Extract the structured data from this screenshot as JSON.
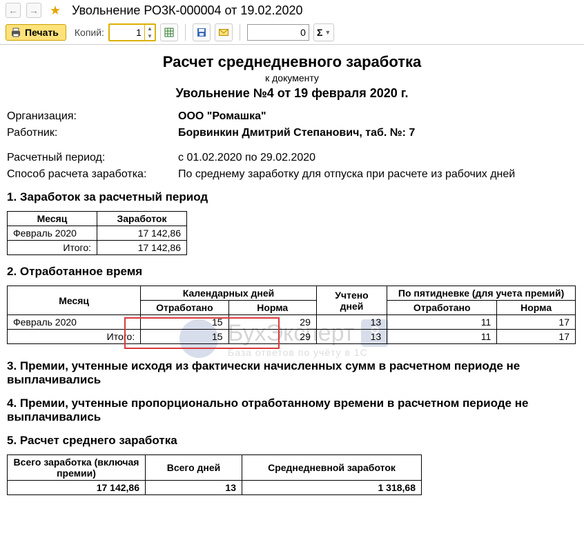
{
  "nav": {
    "back": "←",
    "forward": "→",
    "star": "★",
    "title": "Увольнение РО3К-000004 от 19.02.2020"
  },
  "toolbar": {
    "print_label": "Печать",
    "copies_label": "Копий:",
    "copies_value": "1",
    "num_value": "0",
    "sigma": "Σ"
  },
  "doc": {
    "title1": "Расчет среднедневного заработка",
    "title2": "к документу",
    "title3": "Увольнение №4 от 19 февраля 2020 г.",
    "org_label": "Организация:",
    "org_value": "ООО \"Ромашка\"",
    "worker_label": "Работник:",
    "worker_value": "Борвинкин Дмитрий Степанович, таб. №: 7",
    "period_label": "Расчетный период:",
    "period_value": "с 01.02.2020 по 29.02.2020",
    "method_label": "Способ расчета заработка:",
    "method_value": "По среднему заработку для отпуска при расчете из рабочих дней"
  },
  "s1": {
    "heading": "1. Заработок за расчетный период",
    "h_month": "Месяц",
    "h_earn": "Заработок",
    "row_month": "Февраль 2020",
    "row_earn": "17 142,86",
    "total_label": "Итого:",
    "total_earn": "17 142,86"
  },
  "s2": {
    "heading": "2. Отработанное время",
    "h_month": "Месяц",
    "h_cal": "Календарных дней",
    "h_uch": "Учтено дней",
    "h_five": "По пятидневке (для учета премий)",
    "h_worked": "Отработано",
    "h_norm": "Норма",
    "row_month": "Февраль 2020",
    "r_worked1": "15",
    "r_norm1": "29",
    "r_uch": "13",
    "r_worked2": "11",
    "r_norm2": "17",
    "total_label": "Итого:",
    "t_worked1": "15",
    "t_norm1": "29",
    "t_uch": "13",
    "t_worked2": "11",
    "t_norm2": "17"
  },
  "s3": {
    "heading": "3. Премии, учтенные исходя из фактически начисленных сумм в расчетном периоде не выплачивались"
  },
  "s4": {
    "heading": "4. Премии, учтенные пропорционально отработанному времени в расчетном периоде не выплачивались"
  },
  "s5": {
    "heading": "5. Расчет среднего  заработка",
    "h_total_earn": "Всего заработка (включая премии)",
    "h_total_days": "Всего дней",
    "h_avg": "Среднедневной заработок",
    "v_total_earn": "17 142,86",
    "v_total_days": "13",
    "v_avg": "1 318,68"
  },
  "wm": {
    "title": "БухЭксперт",
    "eight": "8",
    "sub": "База ответов по учёту в 1С"
  }
}
